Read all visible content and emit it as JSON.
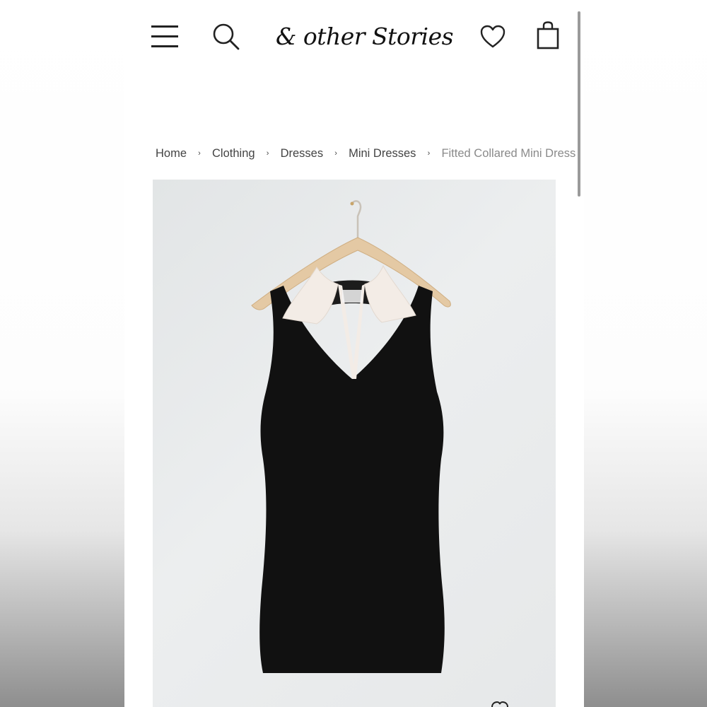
{
  "header": {
    "logo_text": "& other Stories",
    "icons": {
      "menu": "hamburger-menu-icon",
      "search": "search-icon",
      "wishlist": "heart-icon",
      "bag": "shopping-bag-icon"
    }
  },
  "breadcrumb": {
    "items": [
      "Home",
      "Clothing",
      "Dresses",
      "Mini Dresses",
      "Fitted Collared Mini Dress"
    ],
    "separator": "›"
  },
  "product": {
    "image": "photo of black sleeveless knit mini dress with white polo collar on wooden hanger"
  },
  "colors": {
    "text": "#444444",
    "current_crumb": "#8a8a8a",
    "image_bg": "#e6e8e9",
    "dress": "#111111",
    "collar": "#f3ece6",
    "hanger": "#e4c9a4"
  }
}
